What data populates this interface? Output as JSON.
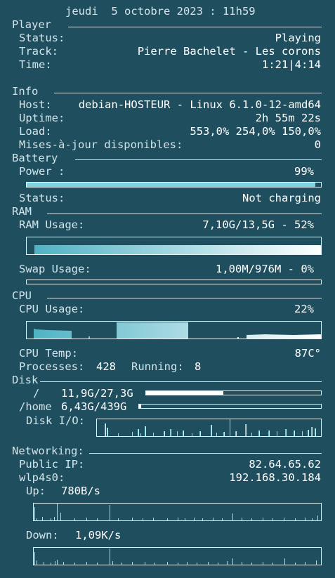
{
  "datetime": "jeudi  5 octobre 2023 : 11h59",
  "player": {
    "header": "Player",
    "status_label": "Status:",
    "status_value": "Playing",
    "track_label": "Track:",
    "track_value": "Pierre Bachelet - Les corons",
    "time_label": "Time:",
    "time_value": "1:21|4:14"
  },
  "info": {
    "header": "Info",
    "host_label": "Host:",
    "host_value": "debian-HOSTEUR - Linux 6.1.0-12-amd64",
    "uptime_label": "Uptime:",
    "uptime_value": "2h 55m 22s",
    "load_label": "Load:",
    "load_value": "553,0% 254,0% 150,0%",
    "updates_label": "Mises-à-jour disponibles:",
    "updates_value": "0"
  },
  "battery": {
    "header": "Battery",
    "power_label": "Power :",
    "power_value": "99%",
    "power_level": 99,
    "status_label": "Status:",
    "status_value": "Not charging"
  },
  "ram": {
    "header": "RAM",
    "ram_label": "RAM Usage:",
    "ram_value": "7,10G/13,5G - 52%",
    "ram_level": 52,
    "swap_label": "Swap Usage:",
    "swap_value": "1,00M/976M - 0%",
    "swap_level": 0
  },
  "cpu": {
    "header": "CPU",
    "usage_label": "CPU Usage:",
    "usage_value": "22%",
    "temp_label": "CPU Temp:",
    "temp_value": "87C°",
    "processes_label": "Processes:",
    "processes_value": "428",
    "running_label": "Running:",
    "running_value": "8"
  },
  "disk": {
    "header": "Disk",
    "root_label": "/",
    "root_value": "11,9G/27,3G",
    "root_level": 44,
    "home_label": "/home",
    "home_value": "6,43G/439G",
    "home_level": 1,
    "io_label": "Disk I/O:"
  },
  "net": {
    "header": "Networking:",
    "public_ip_label": "Public IP:",
    "public_ip_value": "82.64.65.62",
    "iface_label": "wlp4s0:",
    "iface_ip_value": "192.168.30.184",
    "up_label": "Up:",
    "up_value": "780B/s",
    "down_label": "Down:",
    "down_value": "1,09K/s"
  },
  "colors": {
    "background": "#1f4f5f",
    "text": "#d2e4ea",
    "value_text": "#ffffff",
    "graph_start": "#4fb3c4",
    "graph_end": "#ffffff",
    "bar_fill": "#7fd3e0"
  }
}
